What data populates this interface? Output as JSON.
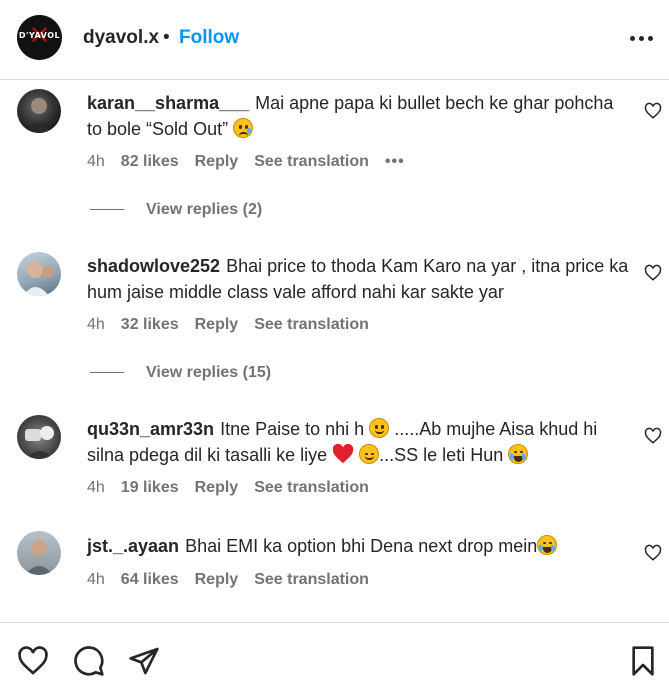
{
  "header": {
    "logo_text": "D'YAVOL",
    "username": "dyavol.x",
    "separator": "•",
    "follow_label": "Follow"
  },
  "comments": [
    {
      "username": "karan__sharma___",
      "text": "Mai apne papa ki bullet bech ke ghar pohcha to bole “Sold Out”",
      "time": "4h",
      "likes": "82 likes",
      "reply_label": "Reply",
      "translation_label": "See translation",
      "view_replies": "View replies (2)"
    },
    {
      "username": "shadowlove252",
      "text": "Bhai price to thoda Kam Karo na yar , itna price ka hum jaise middle class vale afford nahi kar sakte yar",
      "time": "4h",
      "likes": "32 likes",
      "reply_label": "Reply",
      "translation_label": "See translation",
      "view_replies": "View replies (15)"
    },
    {
      "username": "qu33n_amr33n",
      "text_a": "Itne Paise to nhi h",
      "text_b": " .....Ab mujhe Aisa khud hi silna pdega dil ki tasalli ke liye ",
      "text_c": "...SS le leti Hun ",
      "time": "4h",
      "likes": "19 likes",
      "reply_label": "Reply",
      "translation_label": "See translation"
    },
    {
      "username": "jst._.ayaan",
      "text": "Bhai EMI ka option bhi Dena next drop mein",
      "time": "4h",
      "likes": "64 likes",
      "reply_label": "Reply",
      "translation_label": "See translation"
    }
  ],
  "icons": {
    "more": "more-options-icon",
    "like": "heart-outline-icon",
    "comment": "comment-icon",
    "share": "paper-plane-icon",
    "save": "bookmark-icon"
  },
  "colors": {
    "accent": "#0095f6",
    "text": "#262626",
    "secondary": "#737373",
    "divider": "#dbdbdb"
  }
}
